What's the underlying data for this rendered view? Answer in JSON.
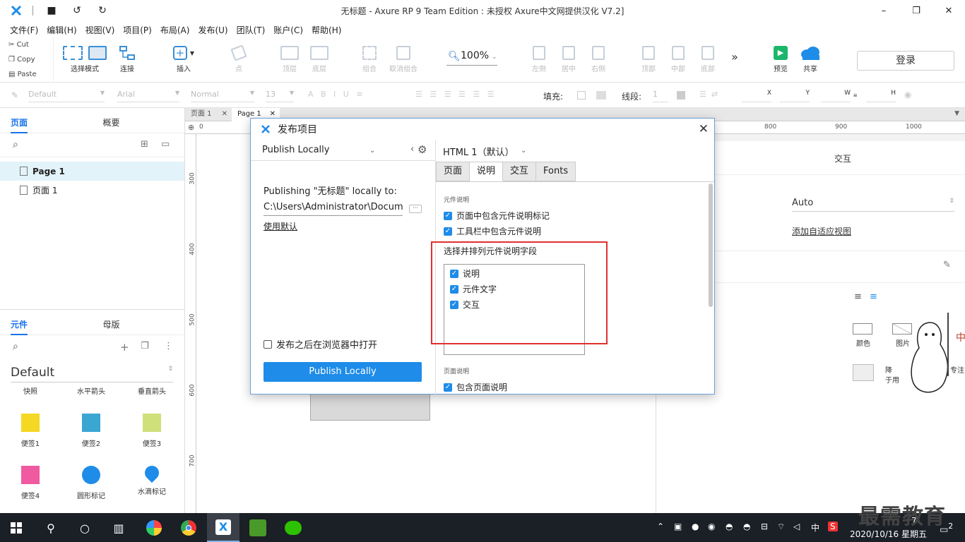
{
  "window": {
    "title": "无标题 - Axure RP 9 Team Edition : 未授权     Axure中文网提供汉化 V7.2]"
  },
  "menu": [
    "文件(F)",
    "编辑(H)",
    "视图(V)",
    "项目(P)",
    "布局(A)",
    "发布(U)",
    "团队(T)",
    "账户(C)",
    "帮助(H)"
  ],
  "clipboard": {
    "cut": "Cut",
    "copy": "Copy",
    "paste": "Paste"
  },
  "toolbar": {
    "select_mode": "选择模式",
    "connect": "连接",
    "insert": "插入",
    "point": "点",
    "top_layer": "顶层",
    "bottom_layer": "底层",
    "group": "组合",
    "ungroup": "取消组合",
    "zoom": "100%",
    "align_left": "左侧",
    "align_center": "居中",
    "align_right": "右侧",
    "align_top": "顶部",
    "align_middle": "中部",
    "align_bottom": "底部",
    "preview": "预览",
    "share": "共享",
    "login": "登录"
  },
  "stylebar": {
    "style": "Default",
    "font": "Arial",
    "weight": "Normal",
    "size": "13",
    "fill": "填充:",
    "stroke": "线段:",
    "stroke_val": "1",
    "x": "X",
    "y": "Y",
    "w": "W",
    "h": "H"
  },
  "pages_panel": {
    "tab_pages": "页面",
    "tab_outline": "概要",
    "items": [
      "Page 1",
      "页面 1"
    ]
  },
  "library_panel": {
    "tab_widgets": "元件",
    "tab_masters": "母版",
    "library": "Default",
    "headers": [
      "快照",
      "水平箭头",
      "垂直箭头"
    ],
    "widgets": [
      {
        "label": "便签1",
        "color": "#f5d823"
      },
      {
        "label": "便签2",
        "color": "#3aa6d2"
      },
      {
        "label": "便签3",
        "color": "#cfe07a"
      },
      {
        "label": "便签4",
        "color": "#ef5aa0"
      },
      {
        "label": "圆形标记",
        "color": "#1e8ce8"
      },
      {
        "label": "水滴标记",
        "color": "#1e8ce8"
      }
    ]
  },
  "doc_tabs": [
    "页面 1",
    "Page 1"
  ],
  "rulers": {
    "top": [
      "0",
      "800",
      "900",
      "1000"
    ],
    "left": [
      "300",
      "400",
      "500",
      "600",
      "700"
    ]
  },
  "right_panel": {
    "tab": "交互",
    "adaptive": "Auto",
    "add_view": "添加自适应视图",
    "icons": [
      "颜色",
      "图片"
    ],
    "partial_text": [
      "降",
      "于用",
      "专注"
    ]
  },
  "dialog": {
    "title": "发布项目",
    "target": "Publish Locally",
    "publishing_label": "Publishing \"无标题\" locally to:",
    "path": "C:\\Users\\Administrator\\Docume",
    "use_default": "使用默认",
    "open_after": "发布之后在浏览器中打开",
    "publish_button": "Publish Locally",
    "format": "HTML 1（默认）",
    "tabs": [
      "页面",
      "说明",
      "交互",
      "Fonts"
    ],
    "section_widget_notes": "元件说明",
    "opt_page_markers": "页面中包含元件说明标记",
    "opt_toolbar_notes": "工具栏中包含元件说明",
    "fields_label": "选择并排列元件说明字段",
    "fields": [
      "说明",
      "元件文字",
      "交互"
    ],
    "section_page_notes": "页面说明",
    "opt_include_page_notes": "包含页面说明"
  },
  "taskbar": {
    "time": "7",
    "date": "2020/10/16 星期五",
    "ime": "中",
    "notifications": "2"
  },
  "watermark": "最需教育"
}
